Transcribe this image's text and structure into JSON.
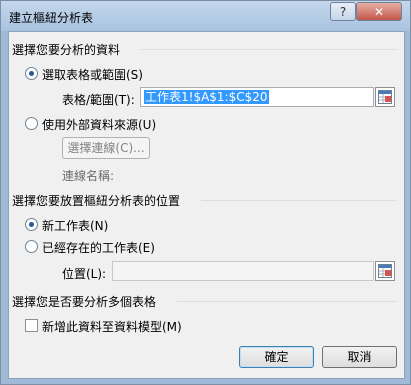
{
  "window": {
    "title": "建立樞紐分析表",
    "help": "?",
    "close": "✕"
  },
  "section1": {
    "heading": "選擇您要分析的資料",
    "option_range": "選取表格或範圍(S)",
    "table_range_label": "表格/範圍(T):",
    "table_range_value": "工作表1!$A$1:$C$20",
    "option_external": "使用外部資料來源(U)",
    "choose_connection": "選擇連線(C)...",
    "connection_name": "連線名稱:"
  },
  "section2": {
    "heading": "選擇您要放置樞紐分析表的位置",
    "option_new": "新工作表(N)",
    "option_existing": "已經存在的工作表(E)",
    "location_label": "位置(L):"
  },
  "section3": {
    "heading": "選擇您是否要分析多個表格",
    "add_to_model": "新增此資料至資料模型(M)"
  },
  "buttons": {
    "ok": "確定",
    "cancel": "取消"
  }
}
